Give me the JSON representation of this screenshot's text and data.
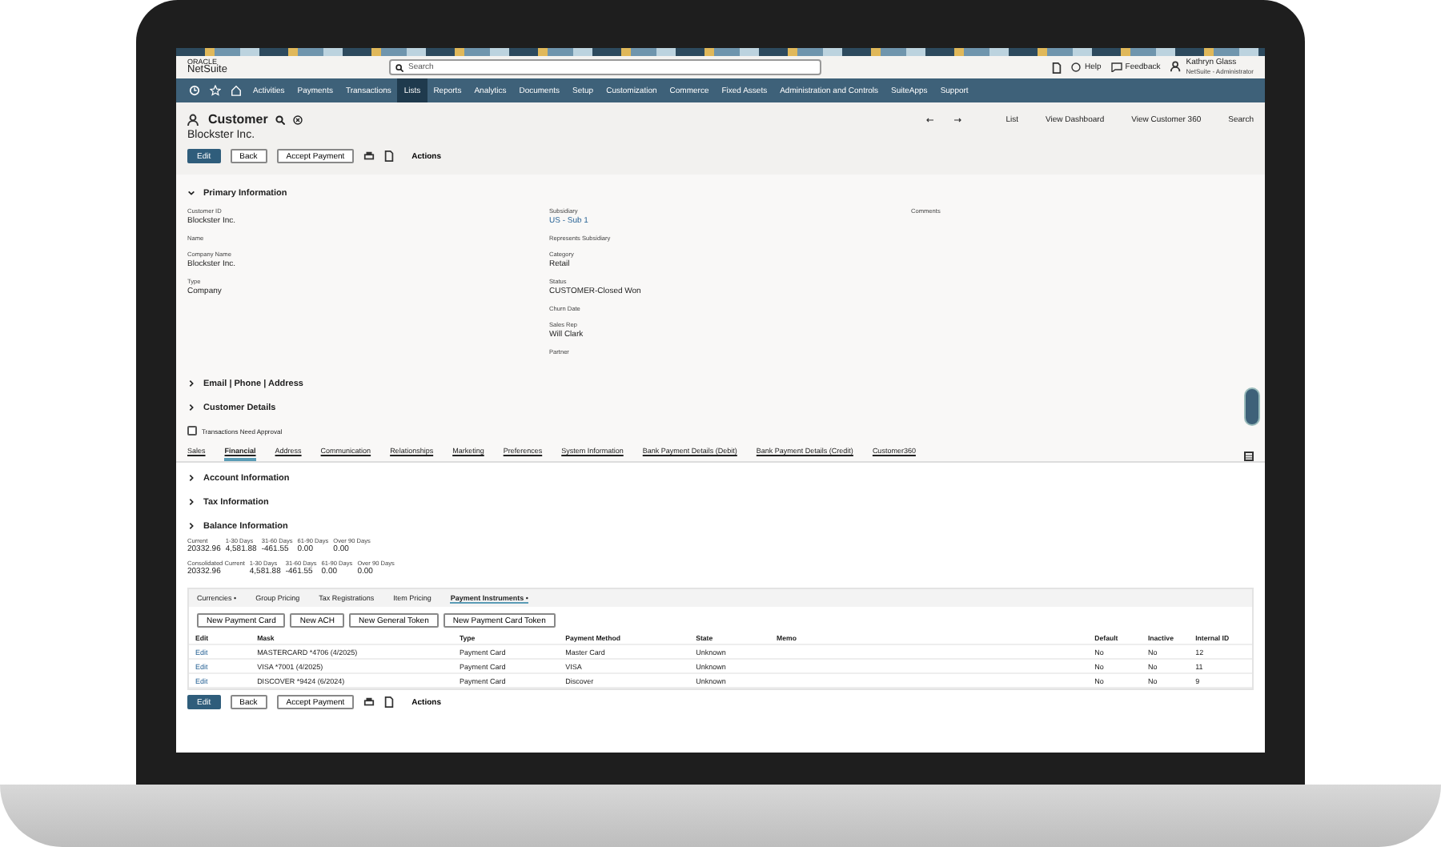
{
  "header": {
    "logo_top": "ORACLE",
    "logo": "NetSuite",
    "search": {
      "placeholder": "Search"
    },
    "help": "Help",
    "feedback": "Feedback",
    "user": {
      "name": "Kathryn Glass",
      "role": "NetSuite - Administrator"
    }
  },
  "nav": [
    {
      "label": "Activities",
      "selected": false
    },
    {
      "label": "Payments",
      "selected": false
    },
    {
      "label": "Transactions",
      "selected": false
    },
    {
      "label": "Lists",
      "selected": true
    },
    {
      "label": "Reports",
      "selected": false
    },
    {
      "label": "Analytics",
      "selected": false
    },
    {
      "label": "Documents",
      "selected": false
    },
    {
      "label": "Setup",
      "selected": false
    },
    {
      "label": "Customization",
      "selected": false
    },
    {
      "label": "Commerce",
      "selected": false
    },
    {
      "label": "Fixed Assets",
      "selected": false
    },
    {
      "label": "Administration and Controls",
      "selected": false
    },
    {
      "label": "SuiteApps",
      "selected": false
    },
    {
      "label": "Support",
      "selected": false
    }
  ],
  "record": {
    "type": "Customer",
    "name": "Blockster Inc.",
    "links": [
      "List",
      "View Dashboard",
      "View Customer 360",
      "Search"
    ],
    "buttons": [
      {
        "label": "Edit",
        "kind": "primary"
      },
      {
        "label": "Back",
        "kind": "secondary"
      },
      {
        "label": "Accept Payment",
        "kind": "secondary"
      },
      {
        "label": "Actions",
        "kind": "menu"
      }
    ]
  },
  "primary": {
    "title": "Primary Information",
    "expanded": true,
    "columns": [
      [
        {
          "label": "Customer ID",
          "value": "Blockster Inc."
        },
        {
          "label": "Name"
        },
        {
          "label": "Company Name",
          "value": "Blockster Inc."
        },
        {
          "label": "Type",
          "value": "Company"
        }
      ],
      [
        {
          "label": "Subsidiary",
          "value": "US - Sub 1",
          "link": true
        },
        {
          "label": "Represents Subsidiary"
        },
        {
          "label": "Category",
          "value": "Retail"
        },
        {
          "label": "Status",
          "value": "CUSTOMER-Closed Won"
        },
        {
          "label": "Churn Date"
        },
        {
          "label": "Sales Rep",
          "value": "Will Clark"
        },
        {
          "label": "Partner"
        }
      ],
      [
        {
          "label": "Comments"
        }
      ]
    ]
  },
  "sections": [
    {
      "title": "Email | Phone | Address",
      "expanded": false
    },
    {
      "title": "Customer Details",
      "expanded": false
    }
  ],
  "approval": {
    "label": "Transactions Need Approval",
    "checked": false
  },
  "tabs": [
    {
      "label": "Sales",
      "selected": false
    },
    {
      "label": "Financial",
      "selected": true
    },
    {
      "label": "Address",
      "selected": false
    },
    {
      "label": "Communication",
      "selected": false
    },
    {
      "label": "Relationships",
      "selected": false
    },
    {
      "label": "Marketing",
      "selected": false
    },
    {
      "label": "Preferences",
      "selected": false
    },
    {
      "label": "System Information",
      "selected": false
    },
    {
      "label": "Bank Payment Details (Debit)",
      "selected": false
    },
    {
      "label": "Bank Payment Details (Credit)",
      "selected": false
    },
    {
      "label": "Customer360",
      "selected": false
    }
  ],
  "subsections": [
    {
      "title": "Account Information",
      "expanded": false
    },
    {
      "title": "Tax Information",
      "expanded": false
    },
    {
      "title": "Balance Information",
      "expanded": false
    }
  ],
  "balance": [
    [
      {
        "label": "Current",
        "value": "20332.96"
      },
      {
        "label": "1-30 Days",
        "value": "4,581.88"
      },
      {
        "label": "31-60 Days",
        "value": "-461.55"
      },
      {
        "label": "61-90 Days",
        "value": "0.00"
      },
      {
        "label": "Over 90 Days",
        "value": "0.00"
      }
    ],
    [
      {
        "label": "Consolidated Current",
        "value": "20332.96"
      },
      {
        "label": "1-30 Days",
        "value": "4,581.88"
      },
      {
        "label": "31-60 Days",
        "value": "-461.55"
      },
      {
        "label": "61-90 Days",
        "value": "0.00"
      },
      {
        "label": "Over 90 Days",
        "value": "0.00"
      }
    ]
  ],
  "subtabs": [
    {
      "label": "Currencies •",
      "selected": false
    },
    {
      "label": "Group Pricing",
      "selected": false
    },
    {
      "label": "Tax Registrations",
      "selected": false
    },
    {
      "label": "Item Pricing",
      "selected": false
    },
    {
      "label": "Payment Instruments •",
      "selected": true
    }
  ],
  "table": {
    "buttons": [
      "New Payment Card",
      "New ACH",
      "New General Token",
      "New Payment Card Token"
    ],
    "columns": [
      "Edit",
      "Mask",
      "Type",
      "Payment Method",
      "State",
      "Memo",
      "Default",
      "Inactive",
      "Internal ID"
    ],
    "rows": [
      [
        "Edit",
        "MASTERCARD *4706 (4/2025)",
        "Payment Card",
        "Master Card",
        "Unknown",
        "",
        "No",
        "No",
        "12"
      ],
      [
        "Edit",
        "VISA *7001 (4/2025)",
        "Payment Card",
        "VISA",
        "Unknown",
        "",
        "No",
        "No",
        "11"
      ],
      [
        "Edit",
        "DISCOVER *9424 (6/2024)",
        "Payment Card",
        "Discover",
        "Unknown",
        "",
        "No",
        "No",
        "9"
      ]
    ]
  },
  "footer_buttons": [
    {
      "label": "Edit",
      "kind": "primary"
    },
    {
      "label": "Back",
      "kind": "secondary"
    },
    {
      "label": "Accept Payment",
      "kind": "secondary"
    },
    {
      "label": "Actions",
      "kind": "menu"
    }
  ]
}
